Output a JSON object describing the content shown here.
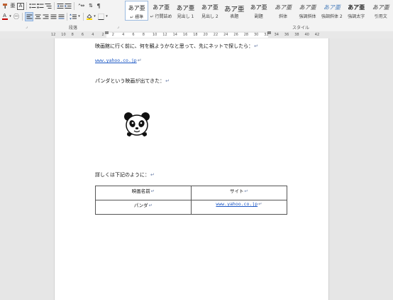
{
  "ribbon": {
    "group_paragraph": "段落",
    "group_styles": "スタイル",
    "styles": [
      {
        "preview": "あア亜",
        "name": "↵ 標準",
        "selected": true
      },
      {
        "preview": "あア亜",
        "name": "↵ 行間詰め",
        "selected": false
      },
      {
        "preview": "あア亜",
        "name": "見出し 1",
        "selected": false
      },
      {
        "preview": "あア亜",
        "name": "見出し 2",
        "selected": false
      },
      {
        "preview": "あア亜",
        "name": "表題",
        "selected": false
      },
      {
        "preview": "あア亜",
        "name": "副題",
        "selected": false
      },
      {
        "preview": "あア亜",
        "name": "斜体",
        "selected": false
      },
      {
        "preview": "あア亜",
        "name": "強調斜体",
        "selected": false
      },
      {
        "preview": "あア亜",
        "name": "強調斜体 2",
        "selected": false
      },
      {
        "preview": "あア亜",
        "name": "強調太字",
        "selected": false
      },
      {
        "preview": "あア亜",
        "name": "引用文",
        "selected": false
      }
    ],
    "font_color": "#c00000",
    "highlight_color": "#ffd700"
  },
  "ruler": {
    "numbers": [
      "12",
      "10",
      "8",
      "6",
      "4",
      "2",
      "2",
      "4",
      "6",
      "8",
      "10",
      "12",
      "14",
      "16",
      "18",
      "20",
      "22",
      "24",
      "26",
      "28",
      "30",
      "32",
      "34",
      "36",
      "38",
      "40",
      "42"
    ]
  },
  "document": {
    "line1": "映画館に行く前に、何を観ようかなと思って、先にネットで探したら：",
    "link1": "www.yahoo.co.jp",
    "line2": "パンダという映画が出てきた：",
    "line3": "詳しくは下記のように：",
    "paragraph_mark": "↵",
    "table": {
      "header": [
        "映画名前",
        "サイト"
      ],
      "rows": [
        [
          "パンダ",
          "www.yahoo.co.jp"
        ]
      ]
    }
  }
}
